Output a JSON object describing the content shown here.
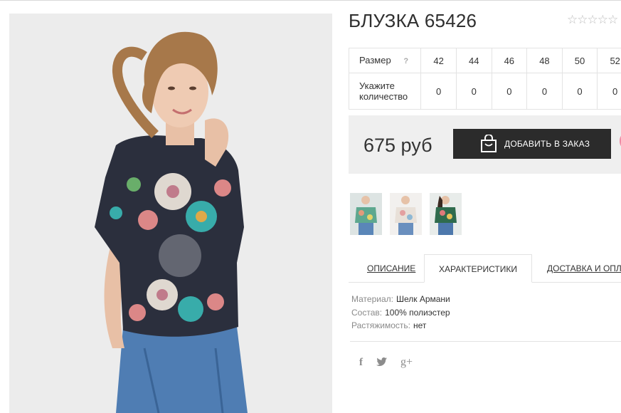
{
  "product": {
    "title": "БЛУЗКА 65426",
    "rating_stars": "☆☆☆☆☆"
  },
  "size_table": {
    "size_label": "Размер",
    "help_mark": "?",
    "quantity_label": "Укажите количество",
    "sizes": [
      "42",
      "44",
      "46",
      "48",
      "50",
      "52"
    ],
    "quantities": [
      "0",
      "0",
      "0",
      "0",
      "0",
      "0"
    ]
  },
  "price": {
    "value": "675 руб",
    "add_button_label": "ДОБАВИТЬ В ЗАКАЗ"
  },
  "tabs": {
    "description": "ОПИСАНИЕ",
    "characteristics": "ХАРАКТЕРИСТИКИ",
    "delivery": "ДОСТАВКА И ОПЛАТА"
  },
  "specs": [
    {
      "key": "Материал:",
      "value": "Шелк Армани"
    },
    {
      "key": "Состав:",
      "value": "100% полиэстер"
    },
    {
      "key": "Растяжимость:",
      "value": "нет"
    }
  ],
  "social": {
    "facebook": "f",
    "twitter": "t",
    "googleplus": "g+"
  },
  "icons": [
    "bag-icon",
    "star-icon",
    "facebook-icon",
    "twitter-icon",
    "google-plus-icon"
  ],
  "colors": {
    "button": "#2b2b2b",
    "price_bg": "#efefef",
    "accent_pink": "#f08aa4"
  }
}
